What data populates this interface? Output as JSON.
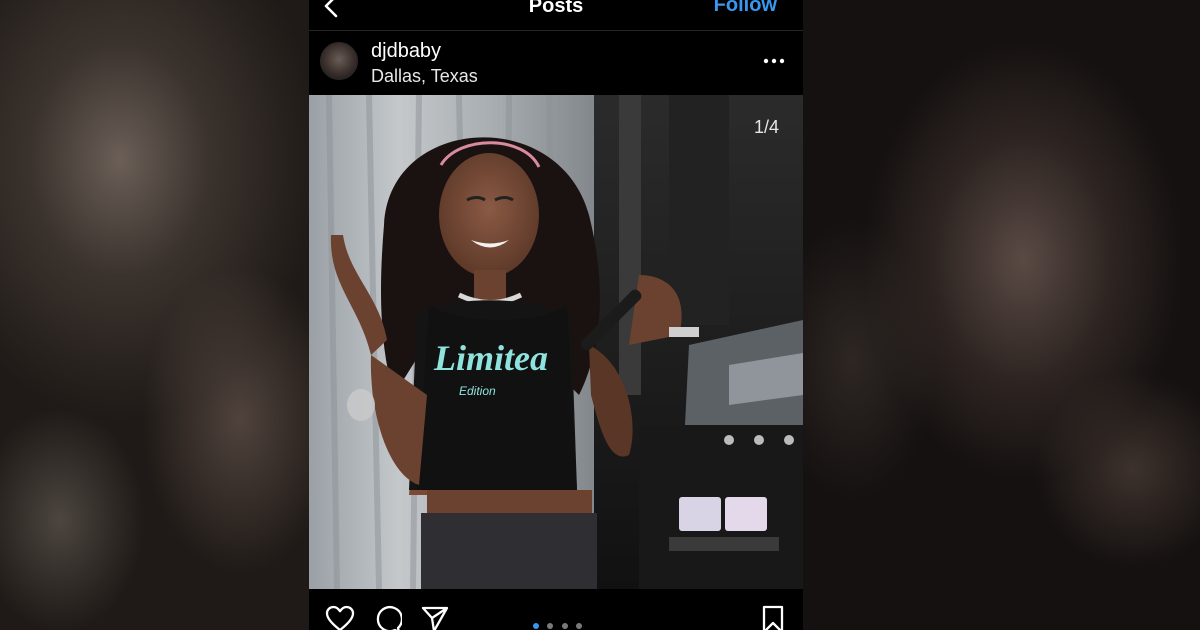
{
  "topbar": {
    "title": "Posts",
    "follow_label": "Follow"
  },
  "post": {
    "username": "djdbaby",
    "location": "Dallas, Texas",
    "image_counter": "1/4",
    "shirt_text": "Limitea",
    "shirt_subtext": "Edition",
    "carousel_dots": 4,
    "active_dot": 1
  },
  "icons": {
    "back": "chevron-left-icon",
    "more": "more-horizontal-icon",
    "like": "heart-icon",
    "comment": "comment-bubble-icon",
    "share": "send-icon",
    "save": "bookmark-icon"
  },
  "colors": {
    "link": "#3897f0",
    "background": "#000000",
    "text": "#ffffff",
    "shirt_print": "#8ee3de"
  }
}
